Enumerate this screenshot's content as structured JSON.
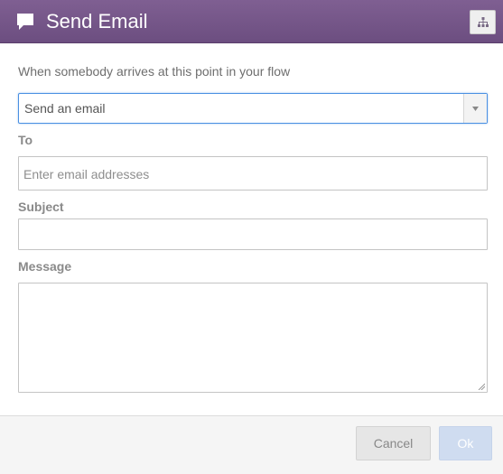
{
  "header": {
    "title": "Send Email",
    "icon": "speech-bubble-icon",
    "action_icon": "flow-tree-icon"
  },
  "form": {
    "intro": "When somebody arrives at this point in your flow",
    "action_select": {
      "value": "Send an email"
    },
    "to": {
      "label": "To",
      "placeholder": "Enter email addresses",
      "value": ""
    },
    "subject": {
      "label": "Subject",
      "value": ""
    },
    "message": {
      "label": "Message",
      "value": ""
    }
  },
  "footer": {
    "cancel_label": "Cancel",
    "ok_label": "Ok"
  },
  "colors": {
    "header_bg": "#7f5f92",
    "focus_border": "#4a90e2",
    "ok_disabled": "#cfdcf0"
  }
}
